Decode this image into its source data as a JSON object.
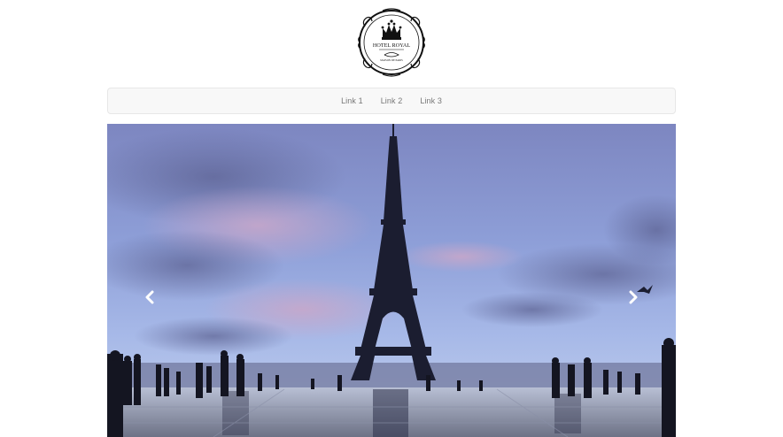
{
  "logo": {
    "line1": "HOTEL ROYAL",
    "line2": "MAISON DE PARIS"
  },
  "navbar": {
    "links": [
      "Link 1",
      "Link 2",
      "Link 3"
    ]
  },
  "carousel": {
    "prev_icon": "chevron-left-icon",
    "next_icon": "chevron-right-icon"
  }
}
